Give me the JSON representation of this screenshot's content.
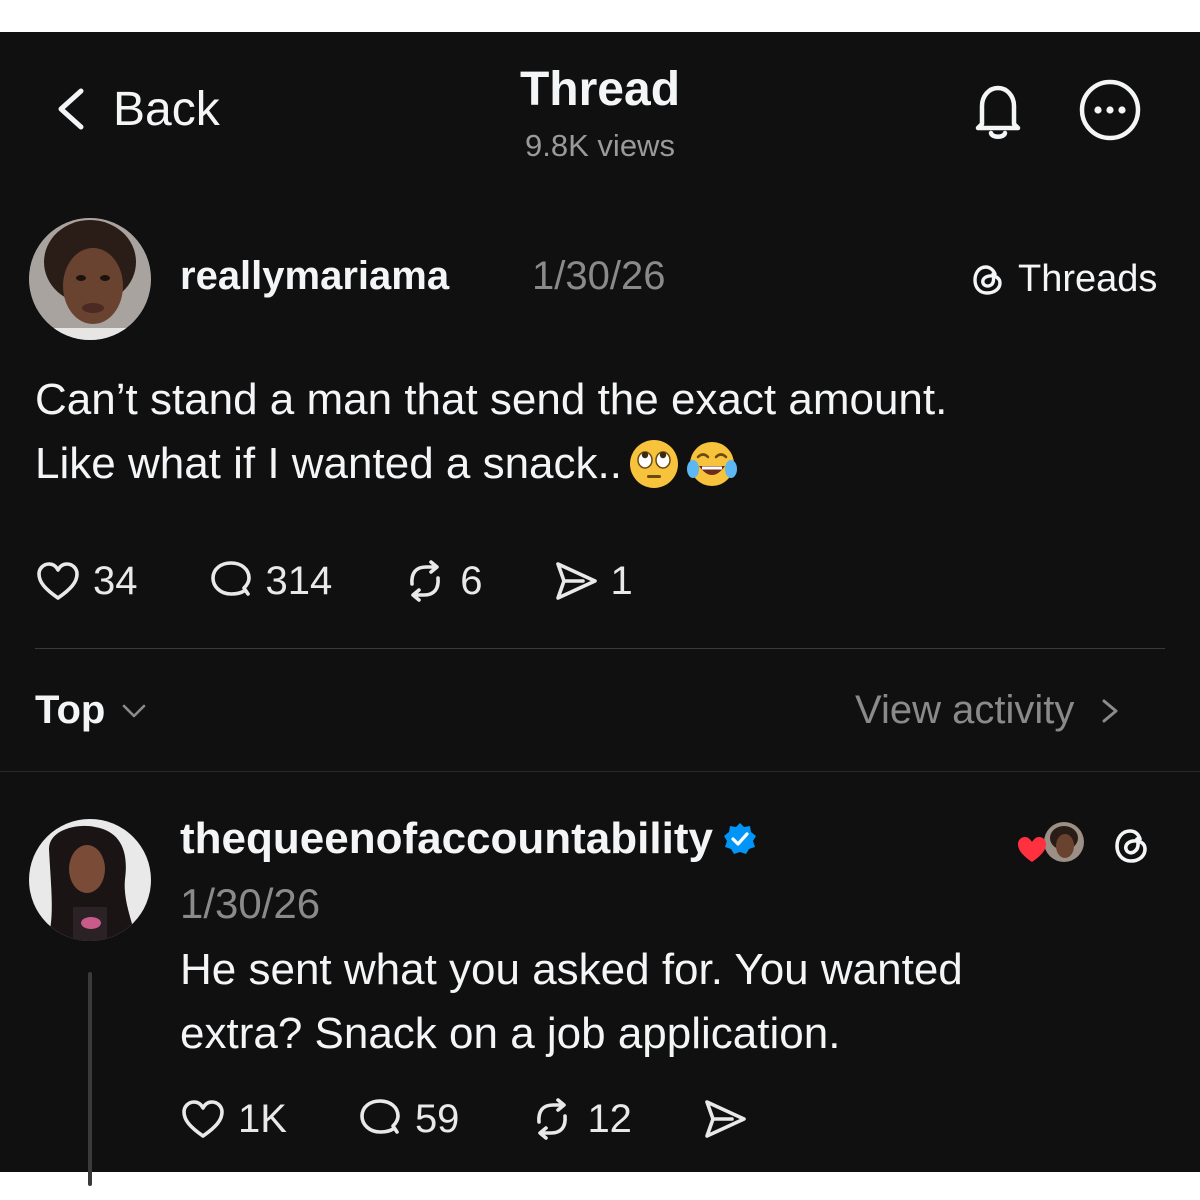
{
  "header": {
    "back_label": "Back",
    "title": "Thread",
    "views": "9.8K views",
    "bell_icon": "bell-icon",
    "more_icon": "more-options-icon"
  },
  "post": {
    "username": "reallymariama",
    "date": "1/30/26",
    "app_label": "Threads",
    "text_line1": "Can’t stand a man that send the exact amount.",
    "text_line2": "Like what if I wanted a snack..",
    "emojis": [
      "eye-roll-emoji",
      "tears-of-joy-emoji"
    ],
    "likes": "34",
    "replies": "314",
    "reposts": "6",
    "shares": "1"
  },
  "sort": {
    "label": "Top",
    "view_activity": "View activity"
  },
  "reply": {
    "username": "thequeenofaccountability",
    "verified": true,
    "date": "1/30/26",
    "text_line1": "He sent what you asked for. You wanted",
    "text_line2": "extra? Snack on a job application.",
    "likes": "1K",
    "replies": "59",
    "reposts": "12"
  },
  "colors": {
    "background": "#101010",
    "text": "#f3f5f7",
    "muted": "#8a8a8a",
    "verified": "#0095f6",
    "heart": "#ff3040"
  }
}
